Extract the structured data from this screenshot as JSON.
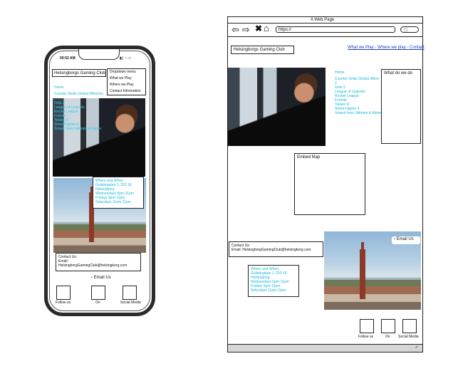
{
  "phone": {
    "status_time": "09:52 AM",
    "site_title": "Helsingborgs Gaming Club",
    "dropdown": [
      "Dropdown menu",
      "What we Play",
      "Where we Play",
      "Contact Information"
    ],
    "home_label": "Home",
    "cyan_line_1": "Counter Strike Global offensive",
    "games_list": [
      "Dota 2",
      "League of Legends",
      "Rocket League",
      "Fortnite",
      "Tekken 8",
      "Street Fighter 6",
      "Smash bros Ultimate & Melee"
    ],
    "where_when": [
      "Where and When:",
      "Gollsbrgatan 1, 252 18",
      "Helsingborg",
      "Wednesdays 6pm-11pm",
      "Fridays 5pm-11pm",
      "Saturdays 11am-11pm"
    ],
    "contact": [
      "Contact Us:",
      "Email:",
      "HelsingborgGamingClub@helsingborg.com"
    ],
    "email_us": "Email Us",
    "footer": [
      "Follow us",
      "On",
      "Social Media"
    ]
  },
  "desktop": {
    "window_title": "A Web Page",
    "url": "https://",
    "site_title": "Helsingborgs Gaming Club",
    "nav_link": "What we Play - Where we play - Contact",
    "home_label": "Home",
    "games_list": [
      "Counter Strike Global offensive",
      "2",
      "Dota 2",
      "League of Legends",
      "Rocket League",
      "Fortnite",
      "Tekken 8",
      "Street Fighter 6",
      "Smash bros Ultimate & Melee"
    ],
    "what_we_do": "What do we do",
    "embed_map": "Embed Map",
    "contact": [
      "Contact Us:",
      "Email: HelsingborgGamingClub@helsingborg.com"
    ],
    "email_us": "Email Us",
    "where_when": [
      "Where and When:",
      "Gollsbrgatan 1, 252 18",
      "Helsingborg",
      "Wednesdays 6pm-11pm",
      "Fridays 5pm-11pm",
      "Saturdays 11am-11pm"
    ],
    "footer": [
      "Follow us",
      "On",
      "Social Media"
    ]
  },
  "colors": {
    "accent": "#19b9d6",
    "link": "#1a3fbf"
  }
}
